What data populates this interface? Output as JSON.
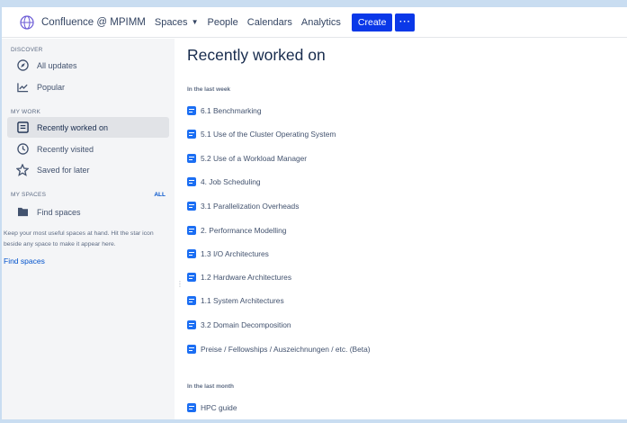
{
  "topbar": {
    "brand": "Confluence @ MPIMM",
    "nav": [
      "Spaces",
      "People",
      "Calendars",
      "Analytics"
    ],
    "create_label": "Create",
    "more_label": "···"
  },
  "sidebar": {
    "discover_title": "DISCOVER",
    "discover_items": [
      {
        "label": "All updates",
        "icon": "compass-icon"
      },
      {
        "label": "Popular",
        "icon": "trending-icon"
      }
    ],
    "mywork_title": "MY WORK",
    "mywork_items": [
      {
        "label": "Recently worked on",
        "icon": "page-icon",
        "active": true
      },
      {
        "label": "Recently visited",
        "icon": "clock-icon"
      },
      {
        "label": "Saved for later",
        "icon": "star-icon"
      }
    ],
    "myspaces_title": "MY SPACES",
    "all_label": "ALL",
    "find_spaces_item": "Find spaces",
    "hint": "Keep your most useful spaces at hand. Hit the star icon beside any space to make it appear here.",
    "find_spaces_link": "Find spaces"
  },
  "main": {
    "title": "Recently worked on",
    "groups": [
      {
        "label": "In the last week",
        "pages": [
          "6.1 Benchmarking",
          "5.1 Use of the Cluster Operating System",
          "5.2 Use of a Workload Manager",
          "4. Job Scheduling",
          "3.1 Parallelization Overheads",
          "2. Performance Modelling",
          "1.3 I/O Architectures",
          "1.2 Hardware Architectures",
          "1.1 System Architectures",
          "3.2 Domain Decomposition",
          "Preise / Fellowships / Auszeichnungen / etc. (Beta)"
        ]
      },
      {
        "label": "In the last month",
        "pages": [
          "HPC guide"
        ]
      }
    ]
  },
  "colors": {
    "accent": "#0a38e8",
    "link": "#0052cc",
    "doc_icon": "#1b6ef3",
    "sidebar_bg": "#f4f5f7",
    "frame": "#c9ddf1"
  }
}
